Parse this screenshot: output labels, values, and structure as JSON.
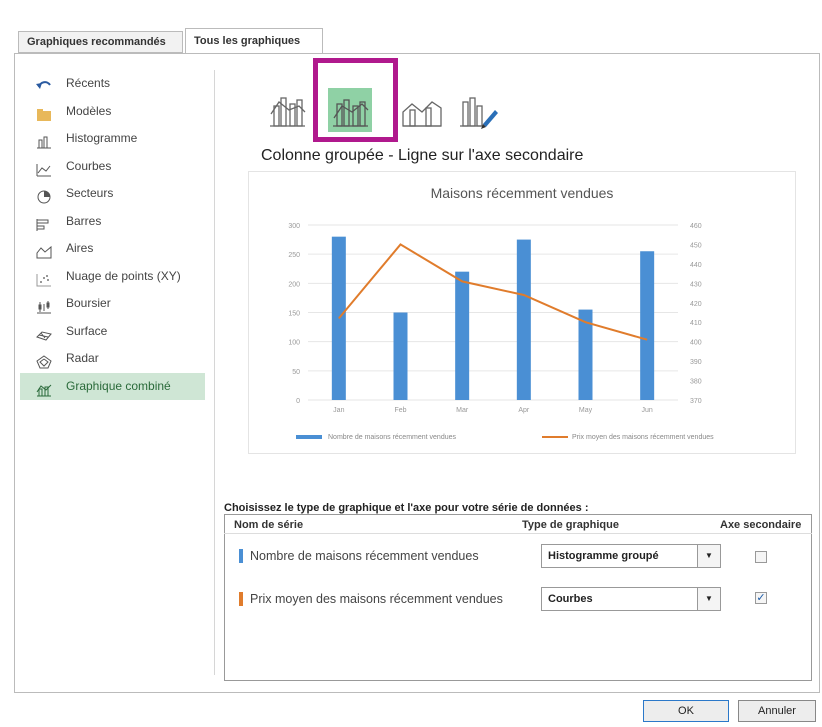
{
  "tabs": [
    "Graphiques recommandés",
    "Tous les graphiques"
  ],
  "chart_types": [
    {
      "label": "Récents",
      "icon": "undo-arrow-icon"
    },
    {
      "label": "Modèles",
      "icon": "folder-icon"
    },
    {
      "label": "Histogramme",
      "icon": "column-chart-icon"
    },
    {
      "label": "Courbes",
      "icon": "line-chart-icon"
    },
    {
      "label": "Secteurs",
      "icon": "pie-chart-icon"
    },
    {
      "label": "Barres",
      "icon": "bar-chart-icon"
    },
    {
      "label": "Aires",
      "icon": "area-chart-icon"
    },
    {
      "label": "Nuage de points (XY)",
      "icon": "scatter-chart-icon"
    },
    {
      "label": "Boursier",
      "icon": "stock-chart-icon"
    },
    {
      "label": "Surface",
      "icon": "surface-chart-icon"
    },
    {
      "label": "Radar",
      "icon": "radar-chart-icon"
    },
    {
      "label": "Graphique combiné",
      "icon": "combo-chart-icon",
      "selected": true
    }
  ],
  "combo_subtype_title": "Colonne groupée - Ligne sur l'axe secondaire",
  "series_caption": "Choisissez le type de graphique et l'axe pour votre série de données :",
  "series_headers": {
    "name": "Nom de série",
    "type": "Type de graphique",
    "axis": "Axe secondaire"
  },
  "series": [
    {
      "name": "Nombre de maisons récemment vendues",
      "type": "Histogramme groupé",
      "secondary": false,
      "color": "#4a8fd4"
    },
    {
      "name": "Prix moyen des maisons récemment vendues",
      "type": "Courbes",
      "secondary": true,
      "color": "#e07c2c"
    }
  ],
  "buttons": {
    "ok": "OK",
    "cancel": "Annuler"
  },
  "chart_data": {
    "type": "bar",
    "title": "Maisons récemment vendues",
    "categories": [
      "Jan",
      "Feb",
      "Mar",
      "Apr",
      "May",
      "Jun"
    ],
    "ylim": [
      0,
      300
    ],
    "yticks": [
      "0",
      "50",
      "100",
      "150",
      "200",
      "250",
      "300"
    ],
    "y2lim": [
      370,
      460
    ],
    "y2ticks": [
      "370",
      "380",
      "390",
      "400",
      "410",
      "420",
      "430",
      "440",
      "450",
      "460"
    ],
    "series": [
      {
        "name": "Nombre de maisons récemment vendues",
        "type": "bar",
        "axis": "primary",
        "values": [
          280,
          150,
          220,
          275,
          155,
          255
        ]
      },
      {
        "name": "Prix moyen des maisons récemment vendues",
        "type": "line",
        "axis": "secondary",
        "values": [
          412,
          450,
          431,
          424,
          410,
          401
        ]
      }
    ],
    "legend": "bottom",
    "colors": {
      "bar": "#4a8fd4",
      "line": "#e07c2c",
      "grid": "#e6e6e6"
    }
  }
}
